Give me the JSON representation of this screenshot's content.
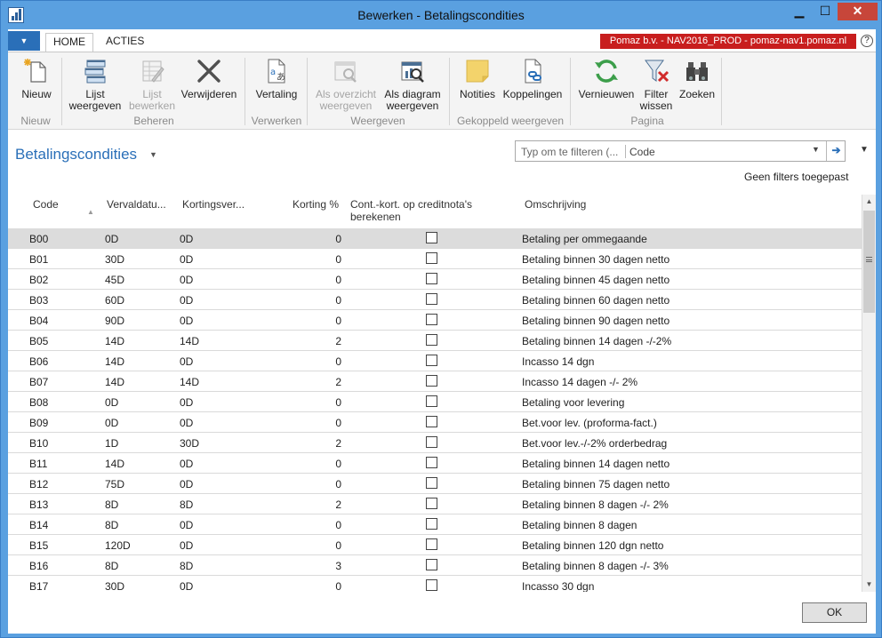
{
  "window": {
    "title": "Bewerken - Betalingscondities",
    "minimize": "▁",
    "maximize": "☐",
    "close": "✕"
  },
  "ribbon_tabs": [
    "HOME",
    "ACTIES"
  ],
  "file_menu_icon": "▼",
  "company": "Pomaz b.v. - NAV2016_PROD - pomaz-nav1.pomaz.nl",
  "help": "?",
  "ribbon": {
    "nieuw": "Nieuw",
    "lijst_weergeven": [
      "Lijst",
      "weergeven"
    ],
    "lijst_bewerken": [
      "Lijst",
      "bewerken"
    ],
    "verwijderen": "Verwijderen",
    "vertaling": "Vertaling",
    "als_overzicht": [
      "Als overzicht",
      "weergeven"
    ],
    "als_diagram": [
      "Als diagram",
      "weergeven"
    ],
    "notities": "Notities",
    "koppelingen": "Koppelingen",
    "vernieuwen": "Vernieuwen",
    "filter_wissen": [
      "Filter",
      "wissen"
    ],
    "zoeken": "Zoeken",
    "groups": {
      "nieuw": "Nieuw",
      "beheren": "Beheren",
      "verwerken": "Verwerken",
      "weergeven": "Weergeven",
      "gekoppeld": "Gekoppeld weergeven",
      "pagina": "Pagina"
    }
  },
  "page": {
    "title": "Betalingscondities",
    "filter_placeholder": "Typ om te filteren (...",
    "filter_field": "Code",
    "no_filters": "Geen filters toegepast"
  },
  "columns": {
    "code": "Code",
    "vervaldatum": "Vervaldatu...",
    "kortingsvervaldatum": "Kortingsver...",
    "korting": "Korting %",
    "cont_kort": [
      "Cont.-kort. op creditnota's",
      "berekenen"
    ],
    "omschrijving": "Omschrijving"
  },
  "rows": [
    {
      "code": "B00",
      "due": "0D",
      "disc_due": "0D",
      "disc": "0",
      "calc": false,
      "desc": "Betaling per ommegaande"
    },
    {
      "code": "B01",
      "due": "30D",
      "disc_due": "0D",
      "disc": "0",
      "calc": false,
      "desc": "Betaling binnen 30 dagen netto"
    },
    {
      "code": "B02",
      "due": "45D",
      "disc_due": "0D",
      "disc": "0",
      "calc": false,
      "desc": "Betaling binnen 45 dagen netto"
    },
    {
      "code": "B03",
      "due": "60D",
      "disc_due": "0D",
      "disc": "0",
      "calc": false,
      "desc": "Betaling binnen 60 dagen netto"
    },
    {
      "code": "B04",
      "due": "90D",
      "disc_due": "0D",
      "disc": "0",
      "calc": false,
      "desc": "Betaling binnen 90 dagen netto"
    },
    {
      "code": "B05",
      "due": "14D",
      "disc_due": "14D",
      "disc": "2",
      "calc": false,
      "desc": "Betaling binnen 14 dagen -/-2%"
    },
    {
      "code": "B06",
      "due": "14D",
      "disc_due": "0D",
      "disc": "0",
      "calc": false,
      "desc": "Incasso 14 dgn"
    },
    {
      "code": "B07",
      "due": "14D",
      "disc_due": "14D",
      "disc": "2",
      "calc": false,
      "desc": "Incasso 14 dagen  -/- 2%"
    },
    {
      "code": "B08",
      "due": "0D",
      "disc_due": "0D",
      "disc": "0",
      "calc": false,
      "desc": "Betaling voor levering"
    },
    {
      "code": "B09",
      "due": "0D",
      "disc_due": "0D",
      "disc": "0",
      "calc": false,
      "desc": "Bet.voor lev. (proforma-fact.)"
    },
    {
      "code": "B10",
      "due": "1D",
      "disc_due": "30D",
      "disc": "2",
      "calc": false,
      "desc": "Bet.voor lev.-/-2% orderbedrag"
    },
    {
      "code": "B11",
      "due": "14D",
      "disc_due": "0D",
      "disc": "0",
      "calc": false,
      "desc": "Betaling binnen 14 dagen netto"
    },
    {
      "code": "B12",
      "due": "75D",
      "disc_due": "0D",
      "disc": "0",
      "calc": false,
      "desc": "Betaling binnen 75 dagen netto"
    },
    {
      "code": "B13",
      "due": "8D",
      "disc_due": "8D",
      "disc": "2",
      "calc": false,
      "desc": "Betaling binnen 8 dagen -/- 2%"
    },
    {
      "code": "B14",
      "due": "8D",
      "disc_due": "0D",
      "disc": "0",
      "calc": false,
      "desc": "Betaling binnen 8 dagen"
    },
    {
      "code": "B15",
      "due": "120D",
      "disc_due": "0D",
      "disc": "0",
      "calc": false,
      "desc": "Betaling binnen 120 dgn netto"
    },
    {
      "code": "B16",
      "due": "8D",
      "disc_due": "8D",
      "disc": "3",
      "calc": false,
      "desc": "Betaling binnen 8 dagen -/- 3%"
    },
    {
      "code": "B17",
      "due": "30D",
      "disc_due": "0D",
      "disc": "0",
      "calc": false,
      "desc": "Incasso 30 dgn"
    }
  ],
  "ok_label": "OK",
  "colors": {
    "accent": "#2a6fb8",
    "titlebar": "#5aa0e0",
    "company_bg": "#c81e1e",
    "close_bg": "#c7463a"
  }
}
